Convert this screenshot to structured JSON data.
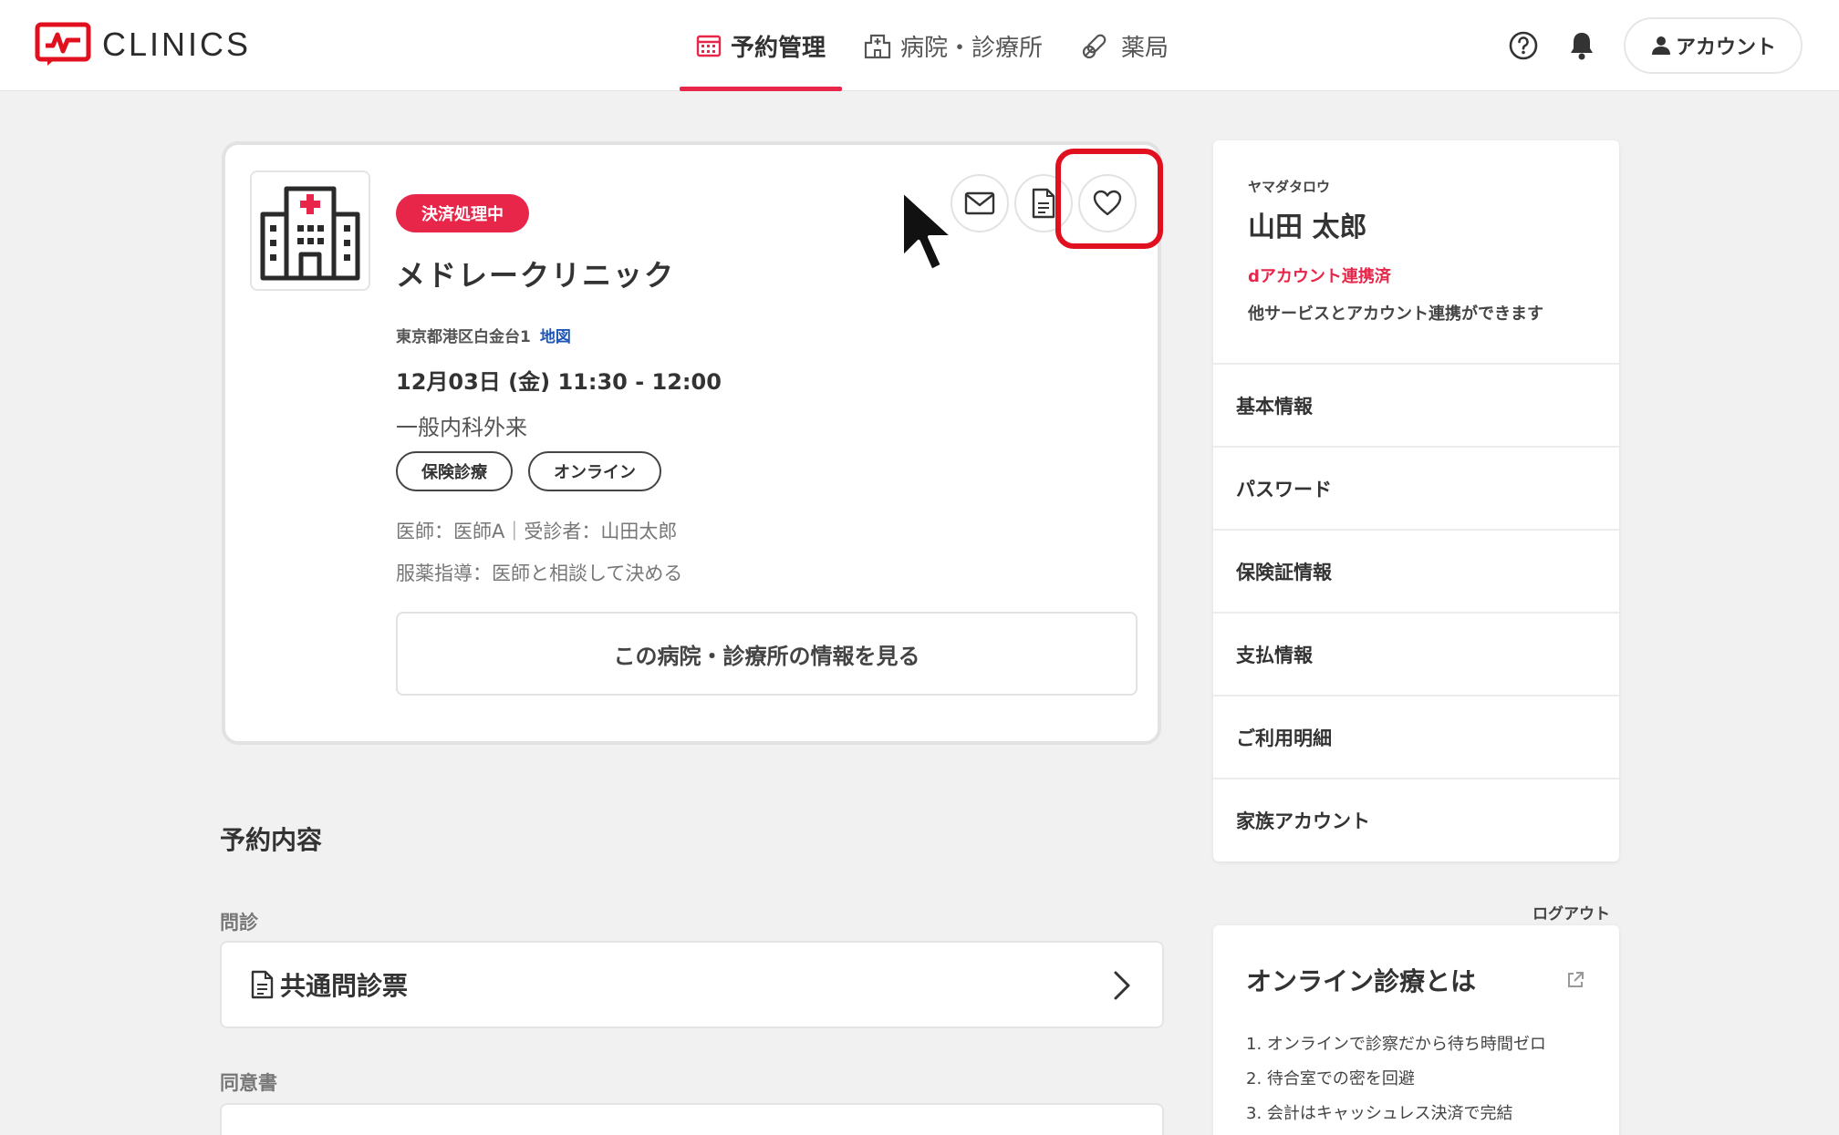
{
  "header": {
    "logo_text": "CLINICS",
    "nav": [
      {
        "label": "予約管理",
        "icon": "calendar-icon",
        "active": true
      },
      {
        "label": "病院・診療所",
        "icon": "hospital-icon",
        "active": false
      },
      {
        "label": "薬局",
        "icon": "pill-icon",
        "active": false
      }
    ],
    "account_label": "アカウント",
    "accent_color": "#e7264a"
  },
  "appointment": {
    "status_badge": "決済処理中",
    "clinic_name": "メドレークリニック",
    "address": "東京都港区白金台1",
    "map_link": "地図",
    "datetime": "12月03日 (金) 11:30 - 12:00",
    "department": "一般内科外来",
    "tags": [
      "保険診療",
      "オンライン"
    ],
    "doctor_line": "医師：医師A｜受診者：山田太郎",
    "guidance_line": "服薬指導：医師と相談して決める",
    "info_button": "この病院・診療所の情報を見る"
  },
  "details": {
    "section_title": "予約内容",
    "interview_label": "問診",
    "interview_item": "共通問診票",
    "consent_label": "同意書"
  },
  "sidebar": {
    "kana": "ヤマダタロウ",
    "name": "山田 太郎",
    "linked": "dアカウント連携済",
    "note": "他サービスとアカウント連携ができます",
    "menu": [
      "基本情報",
      "パスワード",
      "保険証情報",
      "支払情報",
      "ご利用明細",
      "家族アカウント"
    ],
    "logout": "ログアウト"
  },
  "online_info": {
    "title": "オンライン診療とは",
    "items": [
      "1. オンラインで診察だから待ち時間ゼロ",
      "2. 待合室での密を回避",
      "3. 会計はキャッシュレス決済で完結"
    ]
  }
}
